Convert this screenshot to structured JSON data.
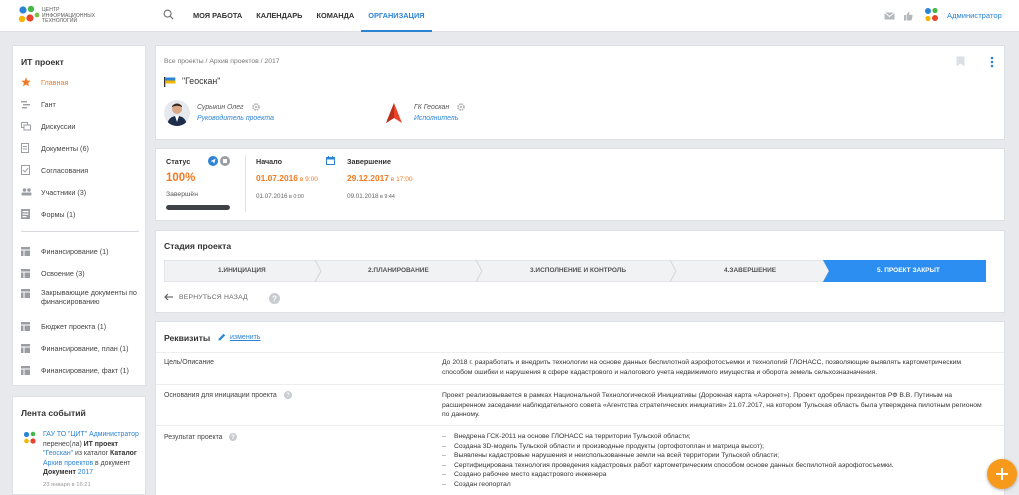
{
  "header": {
    "logo_text": "Центр информационных технологий",
    "nav": [
      {
        "label": "Моя работа"
      },
      {
        "label": "Календарь"
      },
      {
        "label": "Команда"
      },
      {
        "label": "Организация",
        "active": true
      }
    ],
    "user_name": "Администратор"
  },
  "sidebar": {
    "title": "ИТ проект",
    "items": [
      {
        "label": "Главная",
        "icon": "star-icon",
        "active": true
      },
      {
        "label": "Гант",
        "icon": "gantt-icon"
      },
      {
        "label": "Дискуссии",
        "icon": "discussion-icon"
      },
      {
        "label": "Документы (6)",
        "icon": "document-icon"
      },
      {
        "label": "Согласования",
        "icon": "approval-icon"
      },
      {
        "label": "Участники (3)",
        "icon": "people-icon"
      },
      {
        "label": "Формы (1)",
        "icon": "form-icon"
      },
      {
        "label": "Финансирование (1)",
        "icon": "table-icon"
      },
      {
        "label": "Освоение (3)",
        "icon": "table-icon"
      },
      {
        "label": "Закрывающие документы по финансированию",
        "icon": "table-icon"
      },
      {
        "label": "Бюджет проекта (1)",
        "icon": "table-icon"
      },
      {
        "label": "Финансирование, план (1)",
        "icon": "table-icon"
      },
      {
        "label": "Финансирование, факт (1)",
        "icon": "table-icon"
      }
    ]
  },
  "feed": {
    "title": "Лента событий",
    "actor": "ГАУ ТО \"ЦИТ\" Администратор",
    "t1": " перенес(ла) ",
    "obj_type": "ИТ проект",
    "obj_name": "\"Геоскан\"",
    "t2": " из каталог ",
    "cat1_label": "Каталог",
    "cat1": "Архив проектов",
    "t3": " в документ ",
    "cat2_label": "Документ",
    "cat2": "2017",
    "date": "23 января в 16:21"
  },
  "project": {
    "breadcrumbs": "Все проекты / Архив проектов / 2017",
    "title": "\"Геоскан\"",
    "manager_name": "Сурыкин Олег",
    "manager_role": "Руководитель проекта",
    "executor_name": "ГК Геоскан",
    "executor_role": "Исполнитель"
  },
  "status": {
    "label": "Статус",
    "percent": "100%",
    "progress": 1.0,
    "state": "Завершён",
    "start_label": "Начало",
    "start_date": "01.07.2016",
    "start_time": " в 9:00",
    "start_fact_date": "01.07.2016",
    "start_fact_time": " в 0:00",
    "end_label": "Завершение",
    "end_date": "29.12.2017",
    "end_time": " в 17:00",
    "end_fact_date": "09.01.2018",
    "end_fact_time": " в 9:44"
  },
  "stages": {
    "title": "Стадия проекта",
    "items": [
      {
        "label": "1.Инициация"
      },
      {
        "label": "2.Планирование"
      },
      {
        "label": "3.Исполнение и контроль"
      },
      {
        "label": "4.Завершение"
      },
      {
        "label": "5. Проект закрыт",
        "active": true
      }
    ],
    "back_label": "Вернуться назад"
  },
  "requisites": {
    "title": "Реквизиты",
    "edit_label": "изменить",
    "rows": [
      {
        "label": "Цель/Описание",
        "value": "До 2018 г. разработать и внедрить технологии на основе данных беспилотной аэрофотосъемки и технологий ГЛОНАСС, позволяющие выявлять картометрическим способом ошибки и нарушения в сфере кадастрового и налогового учета недвижимого имущества и оборота земель сельхозназначения."
      },
      {
        "label": "Основания для инициации проекта",
        "value": "Проект реализовывается в рамках Национальной Технологической Инициативы (Дорожная карта «Аэронет»). Проект одобрен президентов РФ В.В. Путиным на расширенном заседании наблюдательного совета «Агентства стратегических инициатив» 21.07.2017, на котором Тульская область была утверждена пилотным регионом по данному."
      },
      {
        "label": "Результат проекта",
        "list": [
          "Внедрена ГСК-2011 на основе ГЛОНАСС на территории Тульской области;",
          "Создана 3D-модель Тульской области и производные продукты (ортофотоплан и матрица высот);",
          "Выявлены кадастровые нарушения и неиспользованные земли на всей территории Тульской области;",
          "Сертифицирована технология проведения кадастровых работ картометрическим способом основе данных беспилотной аэрофотосъемки.",
          "Создано рабочее место кадастрового инженера",
          "Создан геопортал"
        ]
      }
    ]
  },
  "colors": {
    "accent": "#2c84d6",
    "orange": "#f07a22",
    "fab": "#f79a1c",
    "stage_active": "#2c8ef0"
  }
}
